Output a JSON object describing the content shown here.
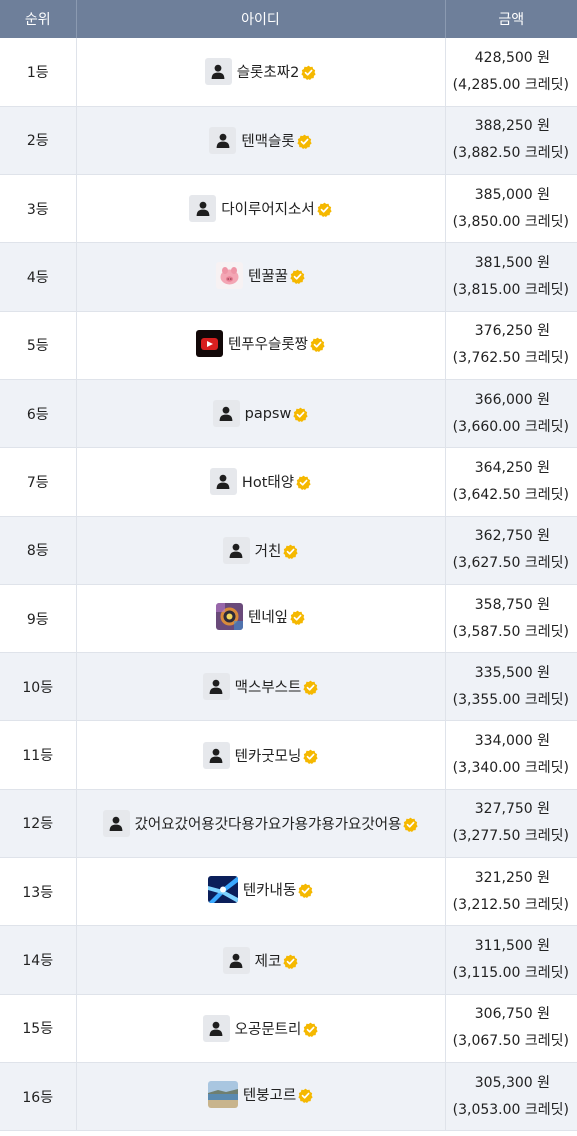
{
  "header": {
    "rank": "순위",
    "id": "아이디",
    "amount": "금액"
  },
  "colors": {
    "header_bg": "#6e7f9a",
    "badge": "#f5b800",
    "row_alt": "#eff2f7"
  },
  "rows": [
    {
      "rank": "1등",
      "name": "슬롯초짜2",
      "avatar": "default",
      "won": "428,500 원",
      "credit": "(4,285.00 크레딧)"
    },
    {
      "rank": "2등",
      "name": "텐맥슬롯",
      "avatar": "default",
      "won": "388,250 원",
      "credit": "(3,882.50 크레딧)"
    },
    {
      "rank": "3등",
      "name": "다이루어지소서",
      "avatar": "default",
      "won": "385,000 원",
      "credit": "(3,850.00 크레딧)"
    },
    {
      "rank": "4등",
      "name": "텐꿀꿀",
      "avatar": "pink-pig",
      "won": "381,500 원",
      "credit": "(3,815.00 크레딧)"
    },
    {
      "rank": "5등",
      "name": "텐푸우슬롯짱",
      "avatar": "red-play",
      "won": "376,250 원",
      "credit": "(3,762.50 크레딧)"
    },
    {
      "rank": "6등",
      "name": "papsw",
      "avatar": "default",
      "won": "366,000 원",
      "credit": "(3,660.00 크레딧)"
    },
    {
      "rank": "7등",
      "name": "Hot태양",
      "avatar": "default",
      "won": "364,250 원",
      "credit": "(3,642.50 크레딧)"
    },
    {
      "rank": "8등",
      "name": "거친",
      "avatar": "default",
      "won": "362,750 원",
      "credit": "(3,627.50 크레딧)"
    },
    {
      "rank": "9등",
      "name": "텐네잎",
      "avatar": "colorful",
      "won": "358,750 원",
      "credit": "(3,587.50 크레딧)"
    },
    {
      "rank": "10등",
      "name": "맥스부스트",
      "avatar": "default",
      "won": "335,500 원",
      "credit": "(3,355.00 크레딧)"
    },
    {
      "rank": "11등",
      "name": "텐카굿모닝",
      "avatar": "default",
      "won": "334,000 원",
      "credit": "(3,340.00 크레딧)"
    },
    {
      "rank": "12등",
      "name": "갔어요갔어용갓다용가요가용갸용가요갓어용",
      "avatar": "default",
      "won": "327,750 원",
      "credit": "(3,277.50 크레딧)"
    },
    {
      "rank": "13등",
      "name": "텐카내동",
      "avatar": "blue-light",
      "won": "321,250 원",
      "credit": "(3,212.50 크레딧)"
    },
    {
      "rank": "14등",
      "name": "제코",
      "avatar": "default",
      "won": "311,500 원",
      "credit": "(3,115.00 크레딧)"
    },
    {
      "rank": "15등",
      "name": "오공문트리",
      "avatar": "default",
      "won": "306,750 원",
      "credit": "(3,067.50 크레딧)"
    },
    {
      "rank": "16등",
      "name": "텐붕고르",
      "avatar": "beach",
      "won": "305,300 원",
      "credit": "(3,053.00 크레딧)"
    }
  ]
}
